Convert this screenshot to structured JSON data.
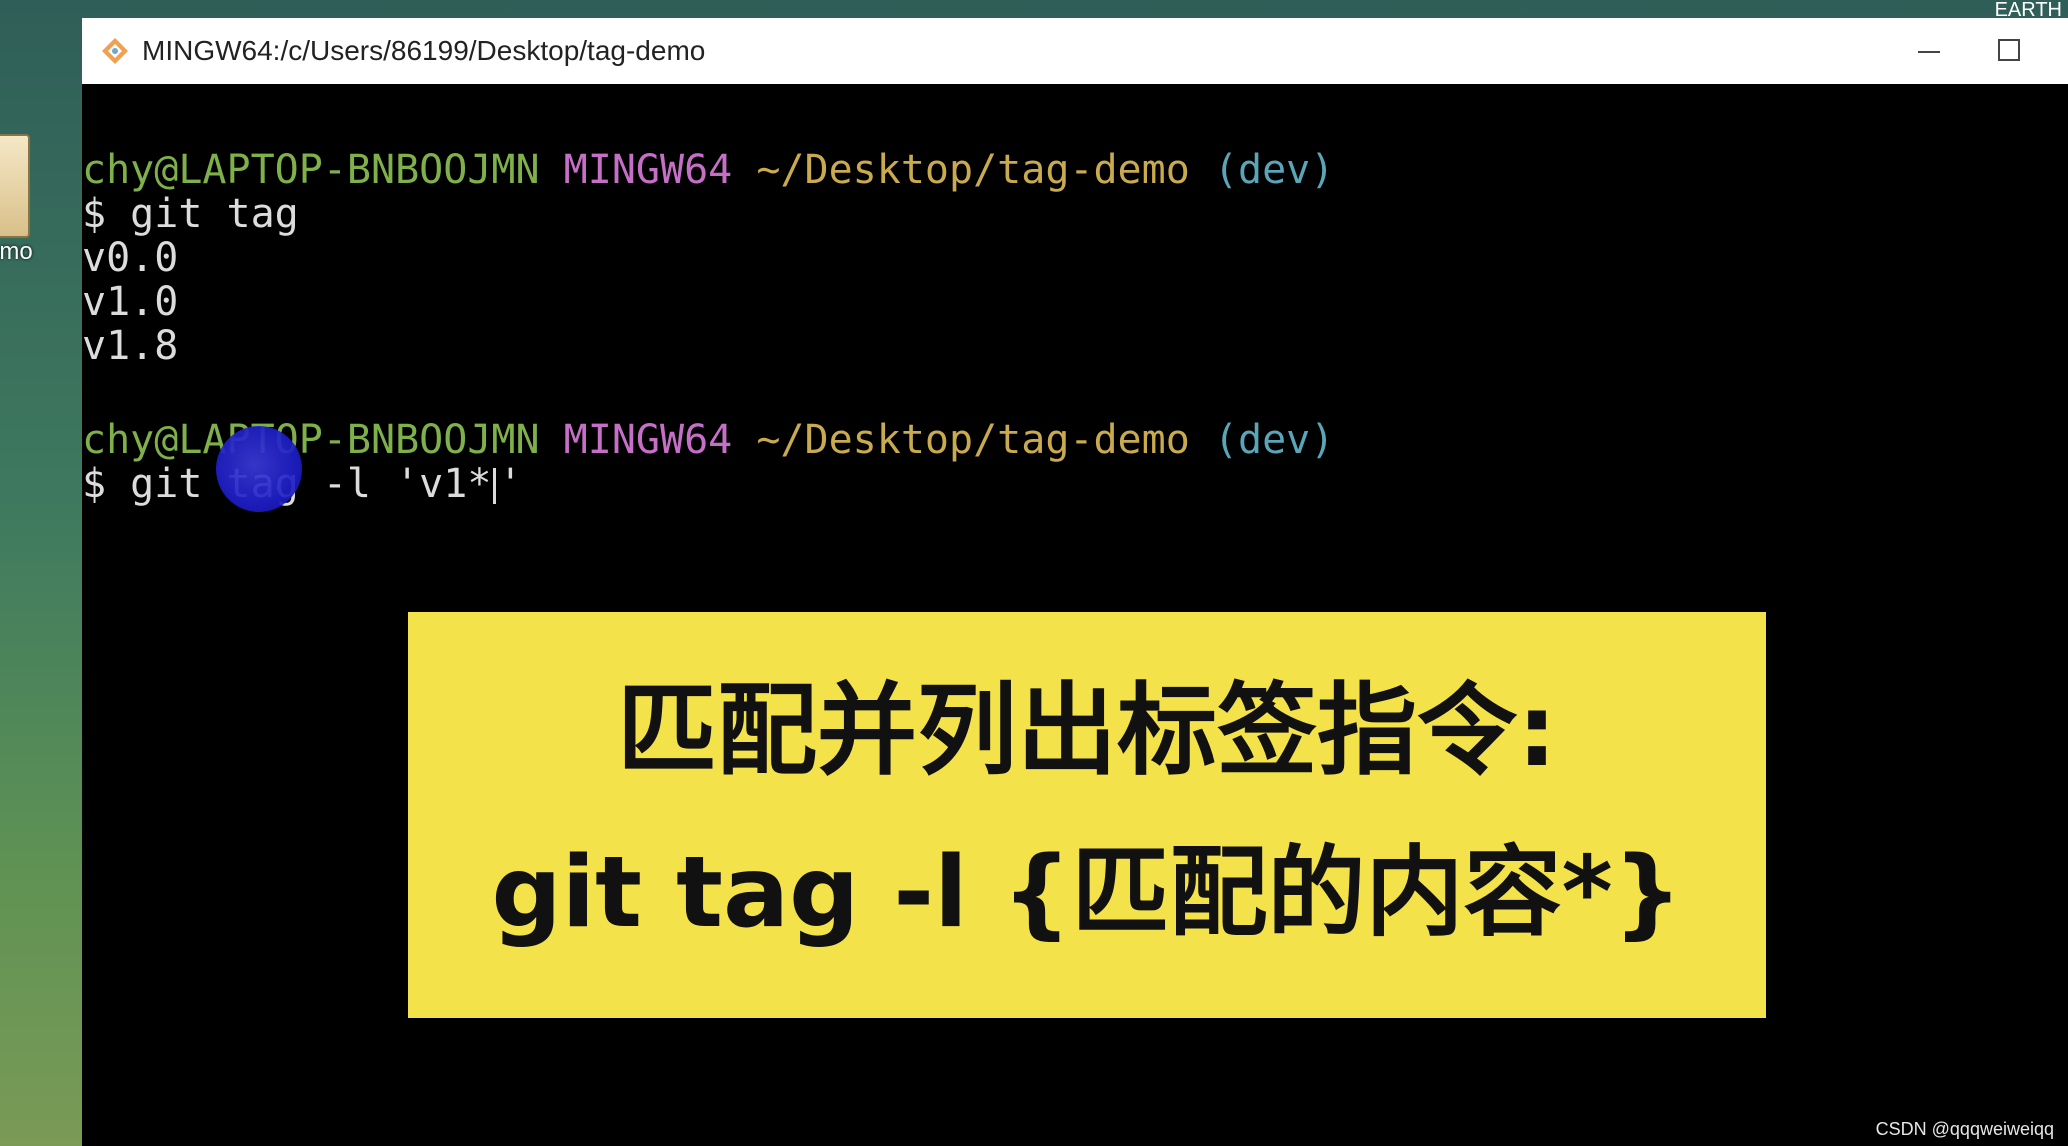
{
  "desktop": {
    "icon_label": "emo",
    "top_right_fragment": "EARTH"
  },
  "window": {
    "title": "MINGW64:/c/Users/86199/Desktop/tag-demo",
    "minimize_icon": "minimize-icon",
    "maximize_icon": "maximize-icon"
  },
  "terminal": {
    "prompt1": {
      "user_host": "chy@LAPTOP-BNBOOJMN",
      "system": "MINGW64",
      "path": "~/Desktop/tag-demo",
      "branch": "(dev)"
    },
    "command1": "$ git tag",
    "output": [
      "v0.0",
      "v1.0",
      "v1.8"
    ],
    "prompt2": {
      "user_host": "chy@LAPTOP-BNBOOJMN",
      "system": "MINGW64",
      "path": "~/Desktop/tag-demo",
      "branch": "(dev)"
    },
    "command2_before_cursor": "$ git tag -l 'v1*",
    "command2_after_cursor": "'"
  },
  "caption": {
    "line1": "匹配并列出标签指令:",
    "line2": "git tag -l {匹配的内容*}"
  },
  "watermark": "CSDN @qqqweiweiqq",
  "colors": {
    "user_host": "#7fb04a",
    "system": "#c66fc6",
    "path": "#c9aa4e",
    "branch": "#5aa5b8",
    "caption_bg": "#f4e24a",
    "terminal_bg": "#000000"
  }
}
